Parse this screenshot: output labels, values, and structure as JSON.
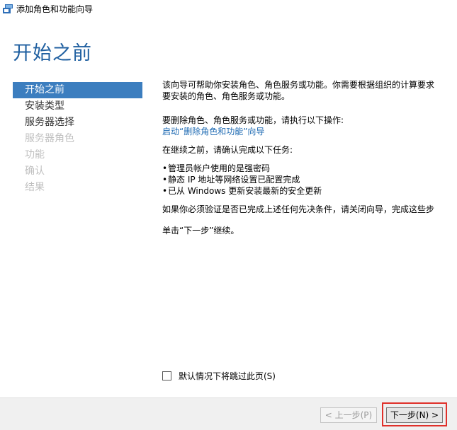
{
  "window": {
    "title": "添加角色和功能向导",
    "icon": "server-manager-icon"
  },
  "page_title": "开始之前",
  "nav": {
    "items": [
      {
        "label": "开始之前",
        "state": "active"
      },
      {
        "label": "安装类型",
        "state": "enabled"
      },
      {
        "label": "服务器选择",
        "state": "enabled"
      },
      {
        "label": "服务器角色",
        "state": "disabled"
      },
      {
        "label": "功能",
        "state": "disabled"
      },
      {
        "label": "确认",
        "state": "disabled"
      },
      {
        "label": "结果",
        "state": "disabled"
      }
    ]
  },
  "content": {
    "intro_line1": "该向导可帮助你安装角色、角色服务或功能。你需要根据组织的计算要求",
    "intro_line2": "要安装的角色、角色服务或功能。",
    "remove_prompt": "要删除角色、角色服务或功能，请执行以下操作:",
    "remove_link": "启动“删除角色和功能”向导",
    "before_continue": "在继续之前，请确认完成以下任务:",
    "tasks": [
      "管理员帐户使用的是强密码",
      "静态 IP 地址等网络设置已配置完成",
      "已从 Windows 更新安装最新的安全更新"
    ],
    "verify_note": "如果你必须验证是否已完成上述任何先决条件，请关闭向导，完成这些步",
    "continue_note": "单击“下一步”继续。"
  },
  "skip_checkbox": {
    "label": "默认情况下将跳过此页(S)",
    "checked": false
  },
  "buttons": {
    "prev": "< 上一步(P)",
    "next": "下一步(N) >"
  },
  "colors": {
    "accent": "#3c7ebf",
    "title": "#1f5fa0",
    "link": "#1f6bb3",
    "highlight": "#e0302a"
  }
}
